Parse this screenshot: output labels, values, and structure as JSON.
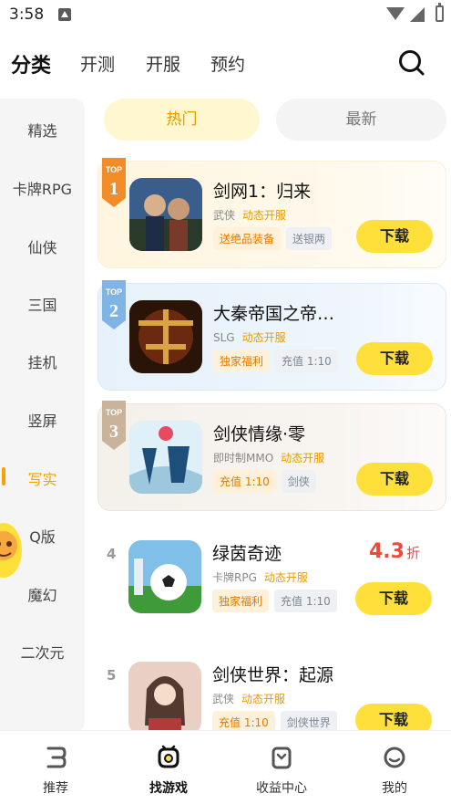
{
  "status_bar": {
    "time": "3:58"
  },
  "header": {
    "tabs": [
      "分类",
      "开测",
      "开服",
      "预约"
    ],
    "active_tab": "分类"
  },
  "sidebar": {
    "items": [
      "精选",
      "卡牌RPG",
      "仙侠",
      "三国",
      "挂机",
      "竖屏",
      "写实",
      "Q版",
      "魔幻",
      "二次元"
    ],
    "active_item": "写实"
  },
  "filters": {
    "hot": "热门",
    "new": "最新",
    "active": "热门"
  },
  "games": [
    {
      "rank_badge": "TOP",
      "rank": "1",
      "name": "剑网1：归来",
      "category": "武侠",
      "server": "动态开服",
      "tags": [
        "送绝品装备",
        "送银两"
      ],
      "tag_styles": [
        "warm",
        "cool"
      ],
      "button": "下载"
    },
    {
      "rank_badge": "TOP",
      "rank": "2",
      "name": "大秦帝国之帝…",
      "category": "SLG",
      "server": "动态开服",
      "tags": [
        "独家福利",
        "充值 1:10"
      ],
      "tag_styles": [
        "warm",
        "cool"
      ],
      "button": "下载"
    },
    {
      "rank_badge": "TOP",
      "rank": "3",
      "name": "剑侠情缘·零",
      "category": "即时制MMO",
      "server": "动态开服",
      "tags": [
        "充值 1:10",
        "剑侠"
      ],
      "tag_styles": [
        "warm",
        "cool"
      ],
      "button": "下载"
    },
    {
      "rank": "4",
      "name": "绿茵奇迹",
      "category": "卡牌RPG",
      "server": "动态开服",
      "tags": [
        "独家福利",
        "充值 1:10"
      ],
      "tag_styles": [
        "warm",
        "cool"
      ],
      "button": "下载",
      "discount": "4.3",
      "discount_unit": "折"
    },
    {
      "rank": "5",
      "name": "剑侠世界：起源",
      "category": "武侠",
      "server": "动态开服",
      "tags": [
        "充值 1:10",
        "剑侠世界"
      ],
      "tag_styles": [
        "warm",
        "cool"
      ],
      "button": "下载"
    }
  ],
  "bottom_nav": {
    "items": [
      "推荐",
      "找游戏",
      "收益中心",
      "我的"
    ],
    "active": "找游戏"
  },
  "colors": {
    "accent": "#f5a300",
    "button": "#ffe03a",
    "discount": "#f04a3c"
  }
}
